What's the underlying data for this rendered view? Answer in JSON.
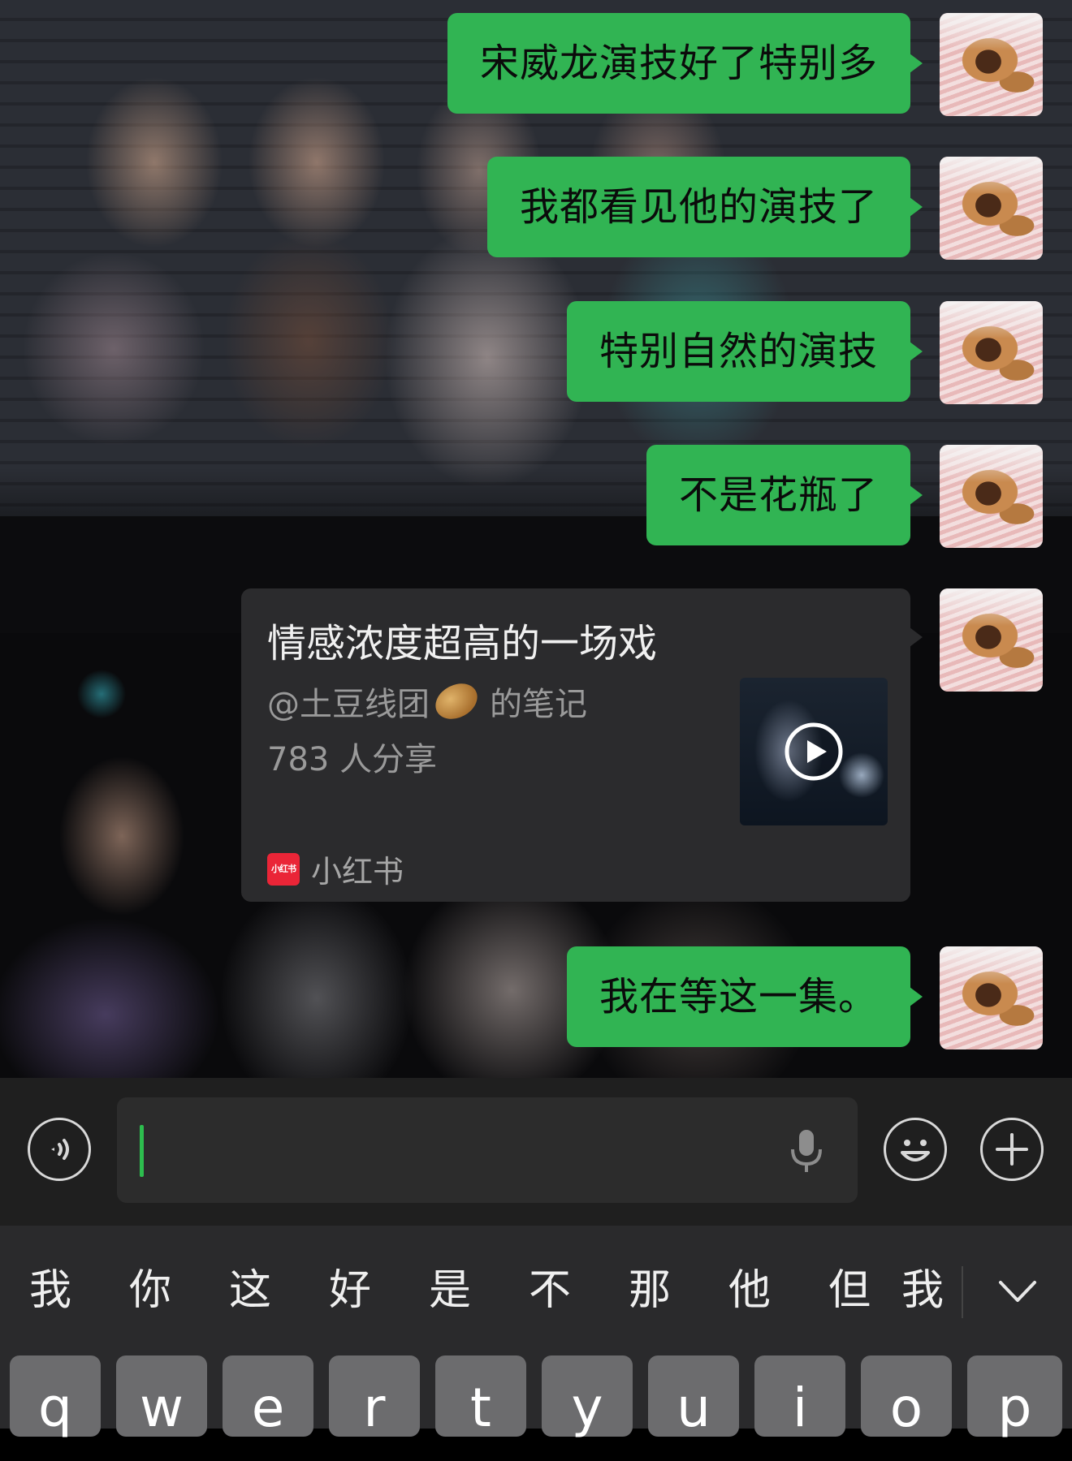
{
  "messages": [
    {
      "text": "宋威龙演技好了特别多"
    },
    {
      "text": "我都看见他的演技了"
    },
    {
      "text": "特别自然的演技"
    },
    {
      "text": "不是花瓶了"
    }
  ],
  "shared_card": {
    "title": "情感浓度超高的一场戏",
    "author_prefix": "@土豆线团",
    "author_suffix": "的笔记",
    "shares": "783 人分享",
    "source": "小红书",
    "source_logo_text": "小红书"
  },
  "last_message": {
    "text": "我在等这一集。"
  },
  "input": {
    "value": ""
  },
  "keyboard": {
    "candidates": [
      "我",
      "你",
      "这",
      "好",
      "是",
      "不",
      "那",
      "他",
      "但",
      "我"
    ],
    "keys": [
      "q",
      "w",
      "e",
      "r",
      "t",
      "y",
      "u",
      "i",
      "o",
      "p"
    ]
  },
  "colors": {
    "bubble_green": "#31b453",
    "caret_green": "#2dbd4e",
    "card_bg": "#2b2b2d",
    "xhs_red": "#ea2537"
  }
}
